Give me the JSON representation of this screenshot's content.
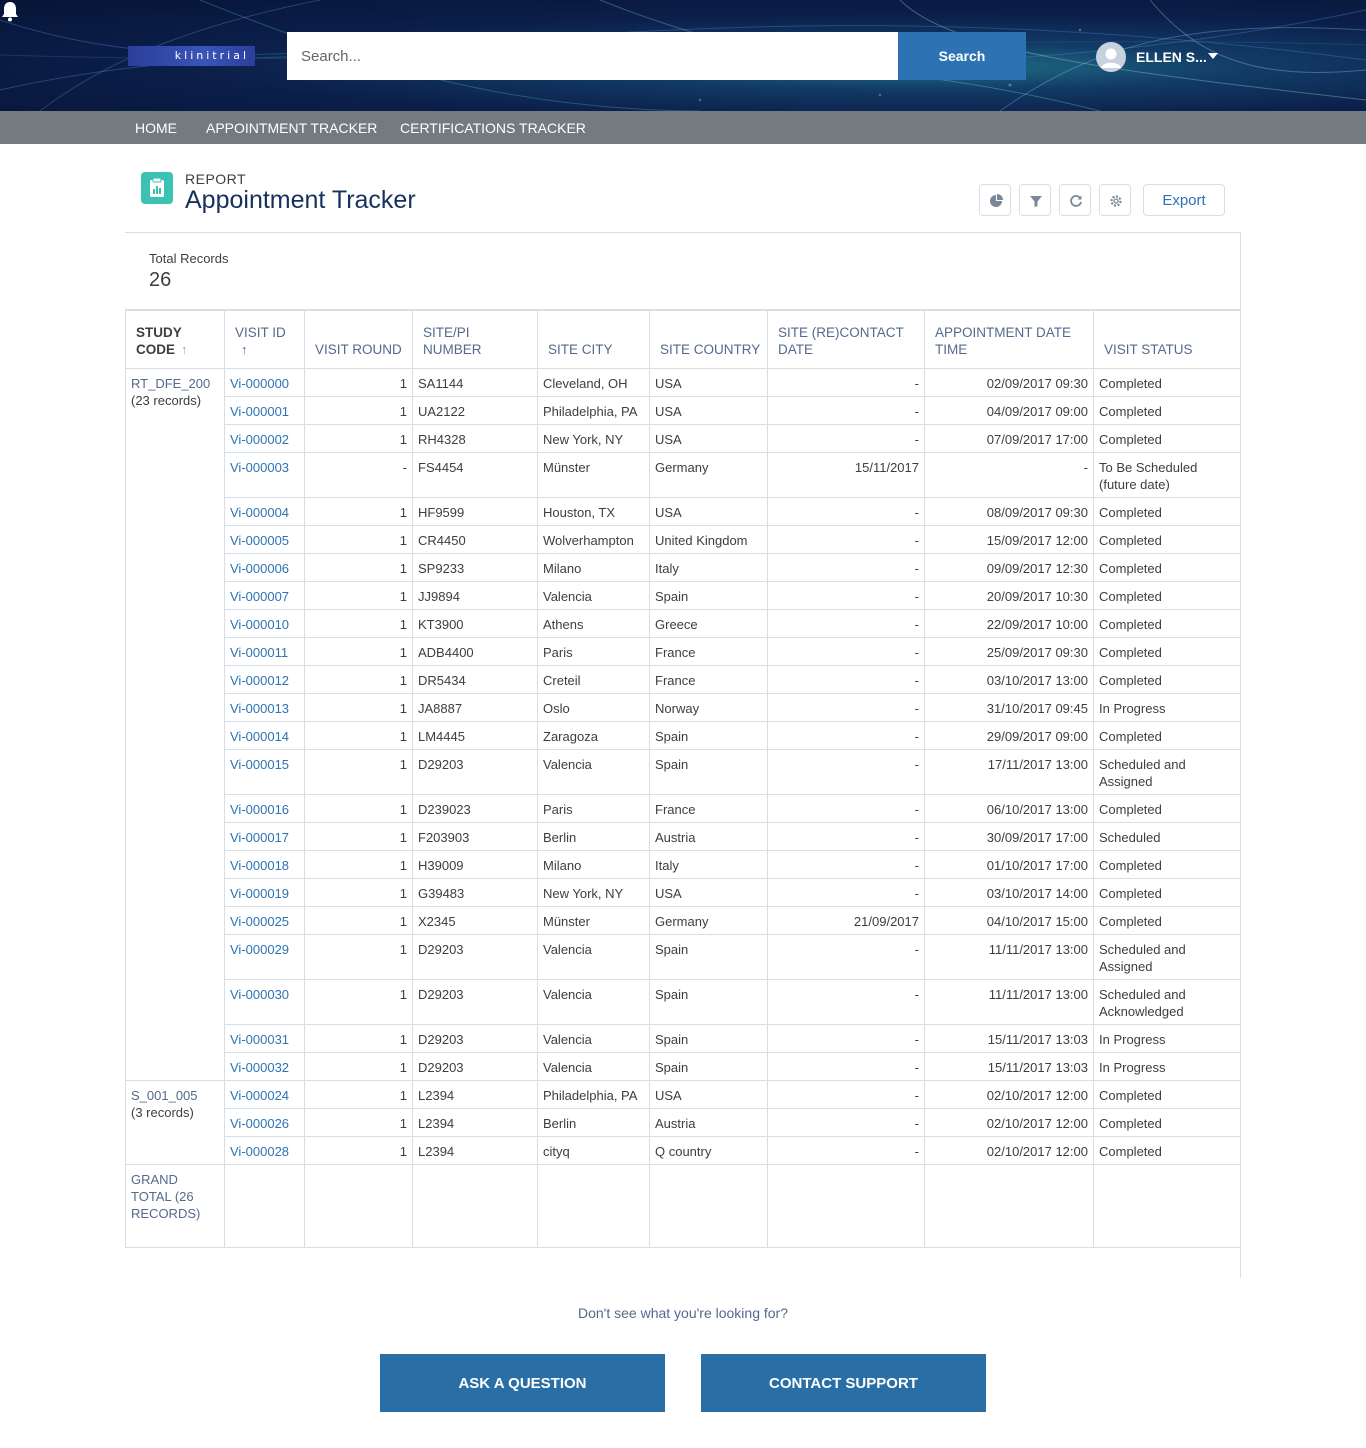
{
  "header": {
    "logo_text": "klinitrial",
    "search_placeholder": "Search...",
    "search_button": "Search",
    "user_name": "ELLEN S..."
  },
  "nav": {
    "items": [
      "HOME",
      "APPOINTMENT TRACKER",
      "CERTIFICATIONS TRACKER"
    ]
  },
  "report": {
    "label": "REPORT",
    "title": "Appointment Tracker",
    "export_label": "Export",
    "total_label": "Total Records",
    "total_value": "26"
  },
  "table": {
    "columns": [
      {
        "label": "STUDY CODE",
        "sort": "asc",
        "dim": true
      },
      {
        "label": "VISIT ID",
        "sort": "asc",
        "dim": false
      },
      {
        "label": "VISIT ROUND"
      },
      {
        "label": "SITE/PI NUMBER"
      },
      {
        "label": "SITE CITY"
      },
      {
        "label": "SITE COUNTRY"
      },
      {
        "label": "SITE (RE)CONTACT DATE"
      },
      {
        "label": "APPOINTMENT DATE TIME"
      },
      {
        "label": "VISIT STATUS"
      }
    ],
    "groups": [
      {
        "code": "RT_DFE_200",
        "count": "(23 records)",
        "rows": [
          [
            "Vi-000000",
            "1",
            "SA1144",
            "Cleveland, OH",
            "USA",
            "-",
            "02/09/2017 09:30",
            "Completed"
          ],
          [
            "Vi-000001",
            "1",
            "UA2122",
            "Philadelphia, PA",
            "USA",
            "-",
            "04/09/2017 09:00",
            "Completed"
          ],
          [
            "Vi-000002",
            "1",
            "RH4328",
            "New York, NY",
            "USA",
            "-",
            "07/09/2017 17:00",
            "Completed"
          ],
          [
            "Vi-000003",
            "-",
            "FS4454",
            "Münster",
            "Germany",
            "15/11/2017",
            "-",
            "To Be Scheduled (future date)"
          ],
          [
            "Vi-000004",
            "1",
            "HF9599",
            "Houston, TX",
            "USA",
            "-",
            "08/09/2017 09:30",
            "Completed"
          ],
          [
            "Vi-000005",
            "1",
            "CR4450",
            "Wolverhampton",
            "United Kingdom",
            "-",
            "15/09/2017 12:00",
            "Completed"
          ],
          [
            "Vi-000006",
            "1",
            "SP9233",
            "Milano",
            "Italy",
            "-",
            "09/09/2017 12:30",
            "Completed"
          ],
          [
            "Vi-000007",
            "1",
            "JJ9894",
            "Valencia",
            "Spain",
            "-",
            "20/09/2017 10:30",
            "Completed"
          ],
          [
            "Vi-000010",
            "1",
            "KT3900",
            "Athens",
            "Greece",
            "-",
            "22/09/2017 10:00",
            "Completed"
          ],
          [
            "Vi-000011",
            "1",
            "ADB4400",
            "Paris",
            "France",
            "-",
            "25/09/2017 09:30",
            "Completed"
          ],
          [
            "Vi-000012",
            "1",
            "DR5434",
            "Creteil",
            "France",
            "-",
            "03/10/2017 13:00",
            "Completed"
          ],
          [
            "Vi-000013",
            "1",
            "JA8887",
            "Oslo",
            "Norway",
            "-",
            "31/10/2017 09:45",
            "In Progress"
          ],
          [
            "Vi-000014",
            "1",
            "LM4445",
            "Zaragoza",
            "Spain",
            "-",
            "29/09/2017 09:00",
            "Completed"
          ],
          [
            "Vi-000015",
            "1",
            "D29203",
            "Valencia",
            "Spain",
            "-",
            "17/11/2017 13:00",
            "Scheduled and Assigned"
          ],
          [
            "Vi-000016",
            "1",
            "D239023",
            "Paris",
            "France",
            "-",
            "06/10/2017 13:00",
            "Completed"
          ],
          [
            "Vi-000017",
            "1",
            "F203903",
            "Berlin",
            "Austria",
            "-",
            "30/09/2017 17:00",
            "Scheduled"
          ],
          [
            "Vi-000018",
            "1",
            "H39009",
            "Milano",
            "Italy",
            "-",
            "01/10/2017 17:00",
            "Completed"
          ],
          [
            "Vi-000019",
            "1",
            "G39483",
            "New York, NY",
            "USA",
            "-",
            "03/10/2017 14:00",
            "Completed"
          ],
          [
            "Vi-000025",
            "1",
            "X2345",
            "Münster",
            "Germany",
            "21/09/2017",
            "04/10/2017 15:00",
            "Completed"
          ],
          [
            "Vi-000029",
            "1",
            "D29203",
            "Valencia",
            "Spain",
            "-",
            "11/11/2017 13:00",
            "Scheduled and Assigned"
          ],
          [
            "Vi-000030",
            "1",
            "D29203",
            "Valencia",
            "Spain",
            "-",
            "11/11/2017 13:00",
            "Scheduled and Acknowledged"
          ],
          [
            "Vi-000031",
            "1",
            "D29203",
            "Valencia",
            "Spain",
            "-",
            "15/11/2017 13:03",
            "In Progress"
          ],
          [
            "Vi-000032",
            "1",
            "D29203",
            "Valencia",
            "Spain",
            "-",
            "15/11/2017 13:03",
            "In Progress"
          ]
        ]
      },
      {
        "code": "S_001_005",
        "count": "(3 records)",
        "rows": [
          [
            "Vi-000024",
            "1",
            "L2394",
            "Philadelphia, PA",
            "USA",
            "-",
            "02/10/2017 12:00",
            "Completed"
          ],
          [
            "Vi-000026",
            "1",
            "L2394",
            "Berlin",
            "Austria",
            "-",
            "02/10/2017 12:00",
            "Completed"
          ],
          [
            "Vi-000028",
            "1",
            "L2394",
            "cityq",
            "Q country",
            "-",
            "02/10/2017 12:00",
            "Completed"
          ]
        ]
      }
    ],
    "grand_total": "GRAND TOTAL (26 RECORDS)"
  },
  "footer": {
    "help_text": "Don't see what you're looking for?",
    "ask_button": "ASK A QUESTION",
    "support_button": "CONTACT SUPPORT"
  }
}
